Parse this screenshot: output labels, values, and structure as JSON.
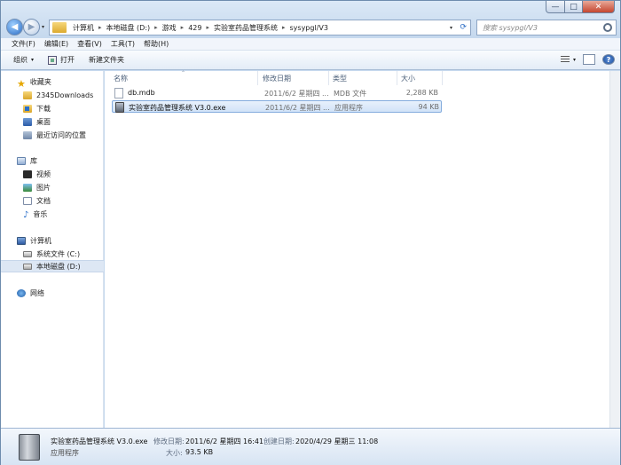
{
  "caption": {
    "minimize": "—",
    "maximize": "□",
    "close": "✕"
  },
  "nav": {
    "back": "◀",
    "forward": "▶",
    "dropdown": "▾"
  },
  "address": {
    "crumbs": [
      "计算机",
      "本地磁盘 (D:)",
      "游戏",
      "429",
      "实验室药品管理系统",
      "sysypgl/V3"
    ],
    "separator": "▸",
    "dropdown": "▾",
    "refresh": "⟳"
  },
  "search": {
    "placeholder": "搜索 sysypgl/V3"
  },
  "menu": [
    "文件(F)",
    "编辑(E)",
    "查看(V)",
    "工具(T)",
    "帮助(H)"
  ],
  "toolbar": {
    "organize": "组织",
    "caret": "▾",
    "open": "打开",
    "new_folder": "新建文件夹",
    "help": "?"
  },
  "navpane": {
    "favorites": "收藏夹",
    "downloads_2345": "2345Downloads",
    "downloads": "下载",
    "desktop": "桌面",
    "recent": "最近访问的位置",
    "libraries": "库",
    "videos": "视频",
    "pictures": "图片",
    "documents": "文档",
    "music": "音乐",
    "computer": "计算机",
    "drive_c": "系统文件 (C:)",
    "drive_d": "本地磁盘 (D:)",
    "network": "网络"
  },
  "columns": {
    "name": "名称",
    "date": "修改日期",
    "type": "类型",
    "size": "大小",
    "sort": "⌃"
  },
  "files": [
    {
      "name": "db.mdb",
      "date": "2011/6/2 星期四 ...",
      "type": "MDB 文件",
      "size": "2,288 KB"
    },
    {
      "name": "实验室药品管理系统 V3.0.exe",
      "date": "2011/6/2 星期四 ...",
      "type": "应用程序",
      "size": "94 KB"
    }
  ],
  "details": {
    "name": "实验室药品管理系统 V3.0.exe",
    "type": "应用程序",
    "modified_label": "修改日期:",
    "modified": "2011/6/2 星期四 16:41",
    "created_label": "创建日期:",
    "created": "2020/4/29 星期三 11:08",
    "size_label": "大小:",
    "size": "93.5 KB"
  }
}
